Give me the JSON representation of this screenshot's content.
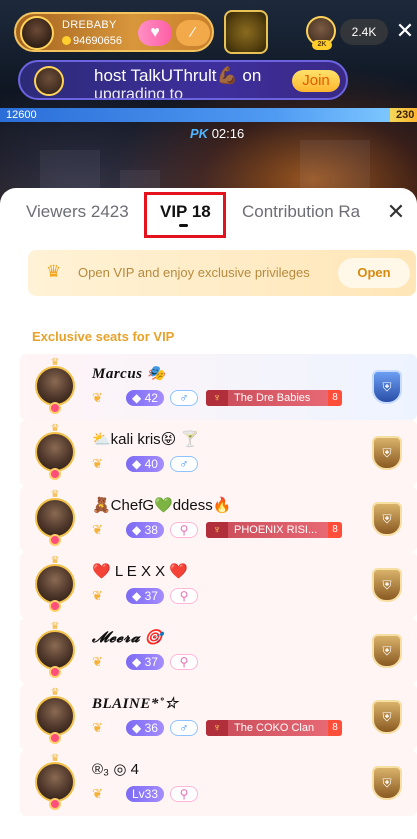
{
  "stream": {
    "host_name": "DREBABY",
    "host_coins": "94690656",
    "viewer_count": "2.4K",
    "viewer_avatar_tag": "2K",
    "close_label": "✕"
  },
  "banner": {
    "text_line1": "host TalkUThrult💪🏾 on",
    "text_line2": "upgrading to",
    "join_label": "Join"
  },
  "pk": {
    "left_score": "12600",
    "right_score": "230",
    "label": "PK",
    "timer": "02:16"
  },
  "tabs": {
    "viewers": "Viewers 2423",
    "vip": "VIP 18",
    "contribution": "Contribution Ra",
    "close_label": "✕"
  },
  "promo": {
    "text": "Open VIP and enjoy exclusive privileges",
    "open_label": "Open"
  },
  "section_title": "Exclusive seats for VIP",
  "vip_rows": [
    {
      "name": "Marcus 🎭",
      "level": "◆ 42",
      "gender": "♂",
      "fanclub": "The Dre Babies",
      "fanclub_level": "8",
      "rank_style": "blue",
      "script": true
    },
    {
      "name": "⛅kali kris😝 🍸",
      "level": "◆ 40",
      "gender": "♂",
      "fanclub": "",
      "fanclub_level": "",
      "rank_style": "gold",
      "script": false
    },
    {
      "name": "🧸ChefG💚ddess🔥",
      "level": "◆ 38",
      "gender": "⚲",
      "fanclub": "PHOENIX RISI...",
      "fanclub_level": "8",
      "rank_style": "gold",
      "script": false
    },
    {
      "name": "❤️ L E X X ❤️",
      "level": "◆ 37",
      "gender": "⚲",
      "fanclub": "",
      "fanclub_level": "",
      "rank_style": "gold",
      "script": false
    },
    {
      "name": "𝓜𝓮𝓮𝓻𝓪 🎯",
      "level": "◆ 37",
      "gender": "⚲",
      "fanclub": "",
      "fanclub_level": "",
      "rank_style": "gold",
      "script": true
    },
    {
      "name": "BLAINE*˚☆",
      "level": "◆ 36",
      "gender": "♂",
      "fanclub": "The COKO Clan",
      "fanclub_level": "8",
      "rank_style": "gold",
      "script": true
    },
    {
      "name": "®₃ ◎ 4",
      "level": "Lv33",
      "gender": "⚲",
      "fanclub": "",
      "fanclub_level": "",
      "rank_style": "gold",
      "script": false
    }
  ],
  "colors": {
    "accent_gold": "#e8a22a",
    "level_purple": "#7b6bf3",
    "highlight_red": "#e3121c"
  }
}
